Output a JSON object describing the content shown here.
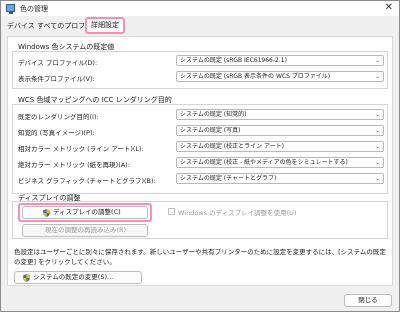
{
  "window": {
    "title": "色の管理",
    "close_glyph": "✕"
  },
  "tabs": [
    {
      "label": "デバイス"
    },
    {
      "label": "すべてのプロファイル"
    },
    {
      "label": "詳細設定"
    }
  ],
  "wcs": {
    "heading": "Windows 色システムの既定値",
    "rows": [
      {
        "label": "デバイス プロファイル(D):",
        "value": "システムの既定 (sRGB IEC61966-2.1)"
      },
      {
        "label": "表示条件プロファイル(V):",
        "value": "システムの既定 (sRGB 表示条件の WCS プロファイル)"
      }
    ]
  },
  "icc": {
    "heading": "WCS 色域マッピングへの ICC レンダリング目的",
    "rows": [
      {
        "label": "既定のレンダリング目的(I):",
        "value": "システムの既定 (知覚的)"
      },
      {
        "label": "知覚的 (写真イメージ)(P):",
        "value": "システムの既定 (写真)"
      },
      {
        "label": "相対カラー メトリック (ライン アート)(L):",
        "value": "システムの既定 (校正とライン アート)"
      },
      {
        "label": "絶対カラー メトリック (紙を再現)(A):",
        "value": "システムの既定 (校正 - 紙やメディアの色をシミュレートする)"
      },
      {
        "label": "ビジネス グラフィック (チャートとグラフ)(B):",
        "value": "システムの既定 (チャートとグラフ)"
      }
    ]
  },
  "display": {
    "heading": "ディスプレイの調整",
    "calibrate_button": "ディスプレイの調整(C)",
    "use_windows_label": "Windows のディスプレイ調整を使用(U)",
    "reload_button": "現在の調整の再読み込み(R)"
  },
  "footer": {
    "note": "色設定はユーザーごとに別々に保存されます。新しいユーザーや共有プリンターのために設定を変更するには、[システムの既定の変更] をクリックしてください。",
    "change_defaults_button": "システムの既定の変更(S)...",
    "close_button": "閉じる"
  },
  "colors": {
    "highlight": "#f78fb3",
    "shield_blue": "#2f6fd6",
    "shield_yellow": "#f2c200"
  }
}
